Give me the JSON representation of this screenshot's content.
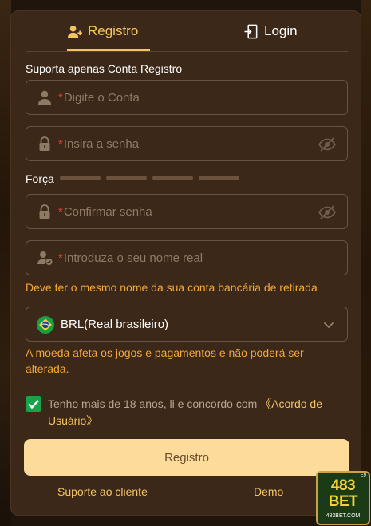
{
  "tabs": {
    "register": "Registro",
    "login": "Login"
  },
  "form": {
    "account_hint": "Suporta apenas Conta Registro",
    "account_placeholder": "Digite o Conta",
    "password_placeholder": "Insira a senha",
    "strength_label": "Força",
    "confirm_placeholder": "Confirmar senha",
    "realname_placeholder": "Introduza o seu nome real",
    "realname_hint": "Deve ter o mesmo nome da sua conta bancária de retirada",
    "required_mark": "*",
    "currency_value": "BRL(Real brasileiro)",
    "currency_hint": "A moeda afeta os jogos e pagamentos e não poderá ser alterada.",
    "agree_text": "Tenho mais de 18 anos, li e concordo com ",
    "agree_link": "《Acordo de Usuário》",
    "agree_checked": true,
    "submit_label": "Registro"
  },
  "footer": {
    "support": "Suporte ao cliente",
    "demo": "Demo"
  },
  "logo": {
    "line1": "483",
    "line2": "BET",
    "domain": "483BET.COM",
    "corner": "E9"
  },
  "colors": {
    "accent": "#f4c463",
    "warning": "#f4a736",
    "check": "#16a34a",
    "button": "#fddc9b",
    "panel": "#3b2818"
  },
  "icons": [
    "user-plus-icon",
    "login-door-icon",
    "user-icon",
    "lock-icon",
    "eye-off-icon",
    "user-check-icon",
    "brazil-flag-icon",
    "chevron-down-icon",
    "check-icon"
  ]
}
